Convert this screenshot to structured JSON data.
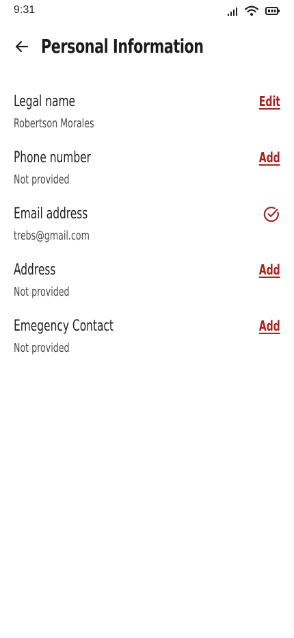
{
  "status_bar": {
    "time": "9:31",
    "icons": [
      "signal-icon",
      "wifi-icon",
      "battery-icon"
    ]
  },
  "header": {
    "title": "Personal Information",
    "back_icon": "arrow-left-icon"
  },
  "accent_color": "#a52222",
  "items": [
    {
      "label": "Legal name",
      "value": "Robertson Morales",
      "action": "Edit"
    },
    {
      "label": "Phone number",
      "value": "Not provided",
      "action": "Add"
    },
    {
      "label": "Email address",
      "value": "trebs@gmail.com",
      "action_icon": "check-circle-icon"
    },
    {
      "label": "Address",
      "value": "Not provided",
      "action": "Add"
    },
    {
      "label": "Emegency Contact",
      "value": "Not provided",
      "action": "Add"
    }
  ]
}
